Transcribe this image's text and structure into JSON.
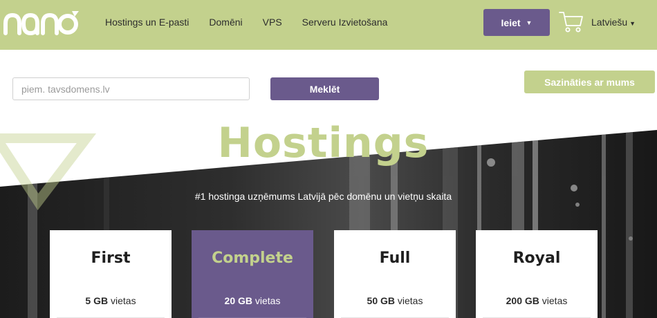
{
  "colors": {
    "accent_green": "#c3d18d",
    "accent_purple": "#6a5a8c",
    "hero_dark": "#2a2a2a"
  },
  "header": {
    "logo": "nano",
    "nav": [
      "Hostings un E-pasti",
      "Domēni",
      "VPS",
      "Serveru Izvietošana"
    ],
    "login_label": "Ieiet",
    "cart_icon": "shopping-cart-icon",
    "language": "Latviešu"
  },
  "search": {
    "placeholder": "piem. tavsdomens.lv",
    "value": "",
    "button_label": "Meklēt"
  },
  "contact_label": "Sazināties ar mums",
  "hero": {
    "title": "Hostings",
    "subtitle": "#1 hostinga uzņēmums Latvijā pēc domēnu un vietņu skaita"
  },
  "plans": [
    {
      "name": "First",
      "space_value": "5 GB",
      "space_label": "vietas",
      "featured": false
    },
    {
      "name": "Complete",
      "space_value": "20 GB",
      "space_label": "vietas",
      "featured": true
    },
    {
      "name": "Full",
      "space_value": "50 GB",
      "space_label": "vietas",
      "featured": false
    },
    {
      "name": "Royal",
      "space_value": "200 GB",
      "space_label": "vietas",
      "featured": false
    }
  ]
}
